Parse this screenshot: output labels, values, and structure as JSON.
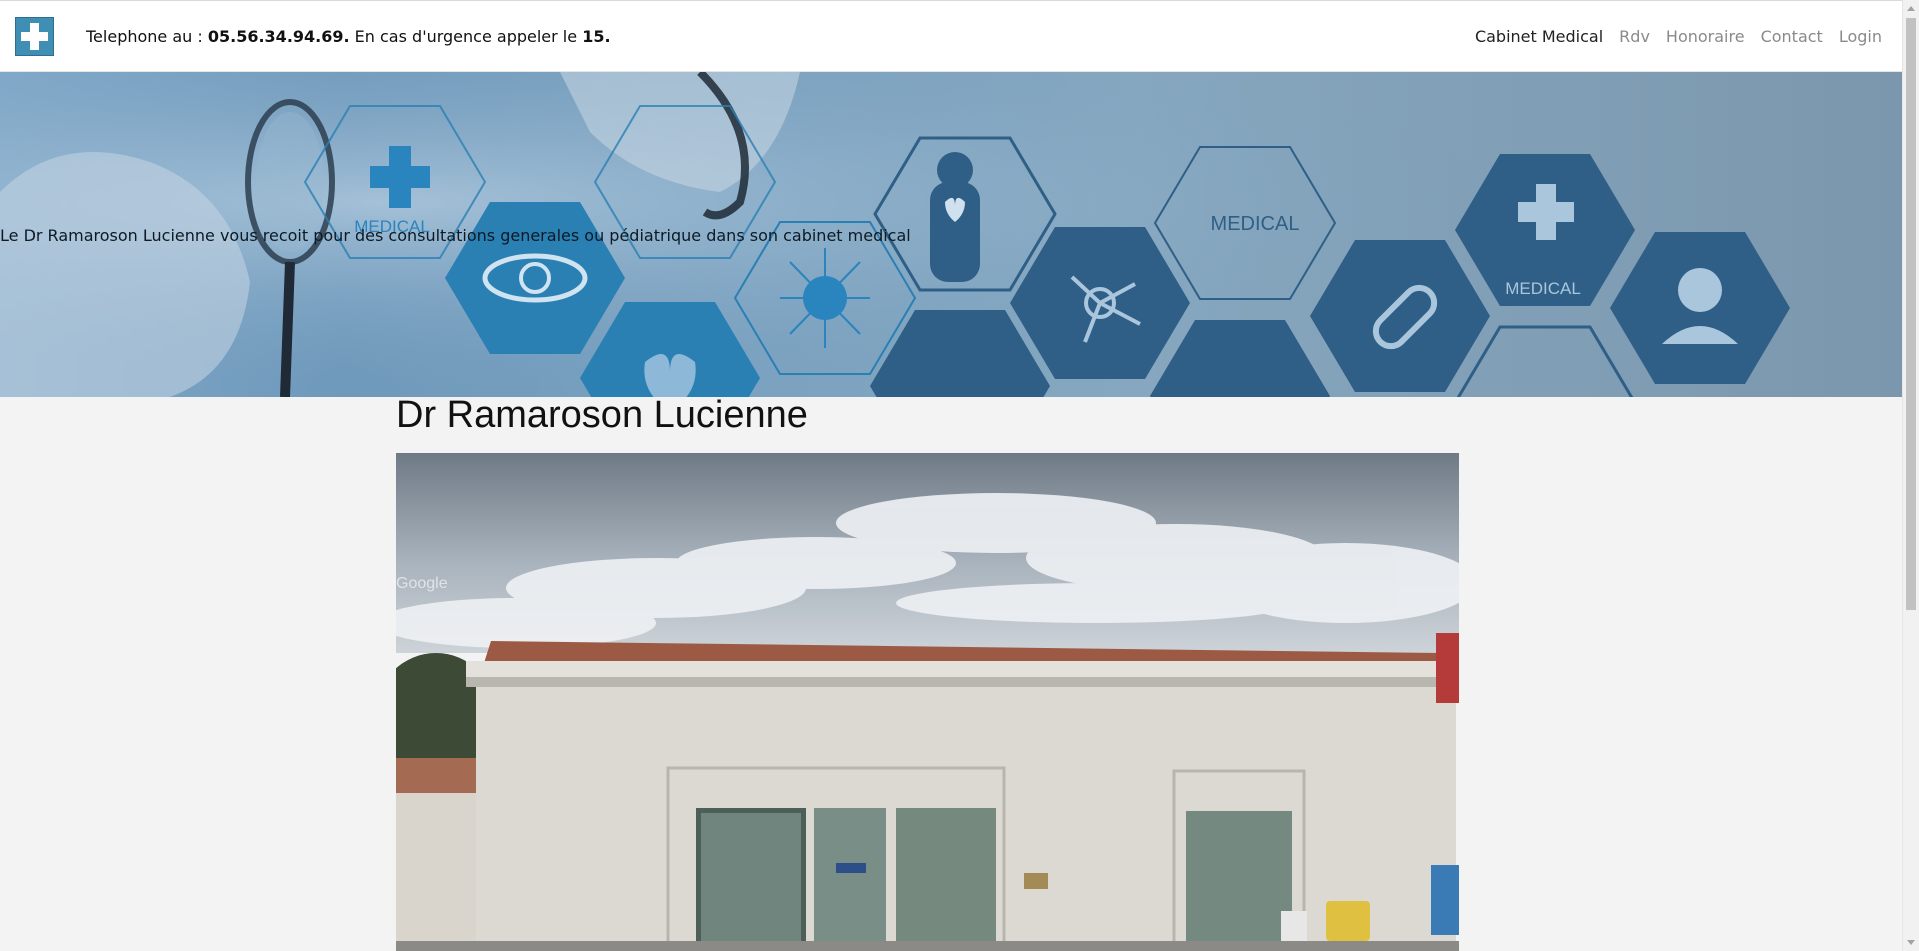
{
  "header": {
    "phone_prefix": "Telephone au :",
    "phone_number": "05.56.34.94.69.",
    "emergency_text": "En cas d'urgence appeler le",
    "emergency_number": "15."
  },
  "nav": {
    "items": [
      {
        "label": "Cabinet Medical",
        "active": true
      },
      {
        "label": "Rdv",
        "active": false
      },
      {
        "label": "Honoraire",
        "active": false
      },
      {
        "label": "Contact",
        "active": false
      },
      {
        "label": "Login",
        "active": false
      }
    ]
  },
  "hero": {
    "text": "Le Dr Ramaroson Lucienne vous recoit pour des consultations generales ou pédiatrique dans son cabinet medical",
    "icon_labels": [
      "MEDICAL",
      "MEDICAL",
      "MEDICAL"
    ]
  },
  "main": {
    "title": "Dr Ramaroson Lucienne",
    "photo_watermark": "Google"
  },
  "colors": {
    "logo": "#3f8fb4",
    "hex_dark": "#2f5f86",
    "hex_blue": "#2a7fb3",
    "nav_active": "#222222",
    "nav_inactive": "#8a8a8a"
  }
}
